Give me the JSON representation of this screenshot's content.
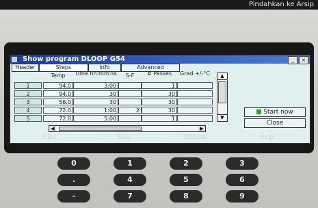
{
  "os_overlay": {
    "text": "Pindahkan ke Arsip"
  },
  "window": {
    "title": "Show program DLOOP G54",
    "controls": {
      "minimize": "_",
      "close": "×"
    }
  },
  "tabs": [
    {
      "label": "Header"
    },
    {
      "label": "Steps"
    },
    {
      "label": "Info"
    },
    {
      "label": "Advanced"
    }
  ],
  "table": {
    "columns": [
      "",
      "Temp",
      "Time hh:mm:ss",
      "S-F",
      "# Passes",
      "Grad +/-°C"
    ],
    "rows": [
      {
        "no": "1",
        "temp": "94.0",
        "time": "3:00",
        "sf": "",
        "passes": "1",
        "grad": ""
      },
      {
        "no": "2",
        "temp": "94.0",
        "time": "30",
        "sf": "",
        "passes": "30",
        "grad": ""
      },
      {
        "no": "3",
        "temp": "56.0",
        "time": "30",
        "sf": "",
        "passes": "30",
        "grad": ""
      },
      {
        "no": "4",
        "temp": "72.0",
        "time": "1:00",
        "sf": "2",
        "passes": "30",
        "grad": ""
      },
      {
        "no": "5",
        "temp": "72.0",
        "time": "5:00",
        "sf": "",
        "passes": "1",
        "grad": ""
      }
    ]
  },
  "buttons": {
    "start_now": "Start now",
    "close": "Close"
  },
  "softkeys": [
    "Files",
    "Run",
    "Options",
    "Help"
  ],
  "keypad": [
    {
      "label": "0"
    },
    {
      "label": "1"
    },
    {
      "label": "2"
    },
    {
      "label": "3"
    },
    {
      "label": "."
    },
    {
      "label": "4"
    },
    {
      "label": "5"
    },
    {
      "label": "6"
    },
    {
      "label": "-"
    },
    {
      "label": "7"
    },
    {
      "label": "8"
    },
    {
      "label": "9"
    }
  ],
  "colors": {
    "screen_bg": "#dff0ef",
    "titlebar": "#1c3ea6",
    "bezel": "#171717"
  }
}
